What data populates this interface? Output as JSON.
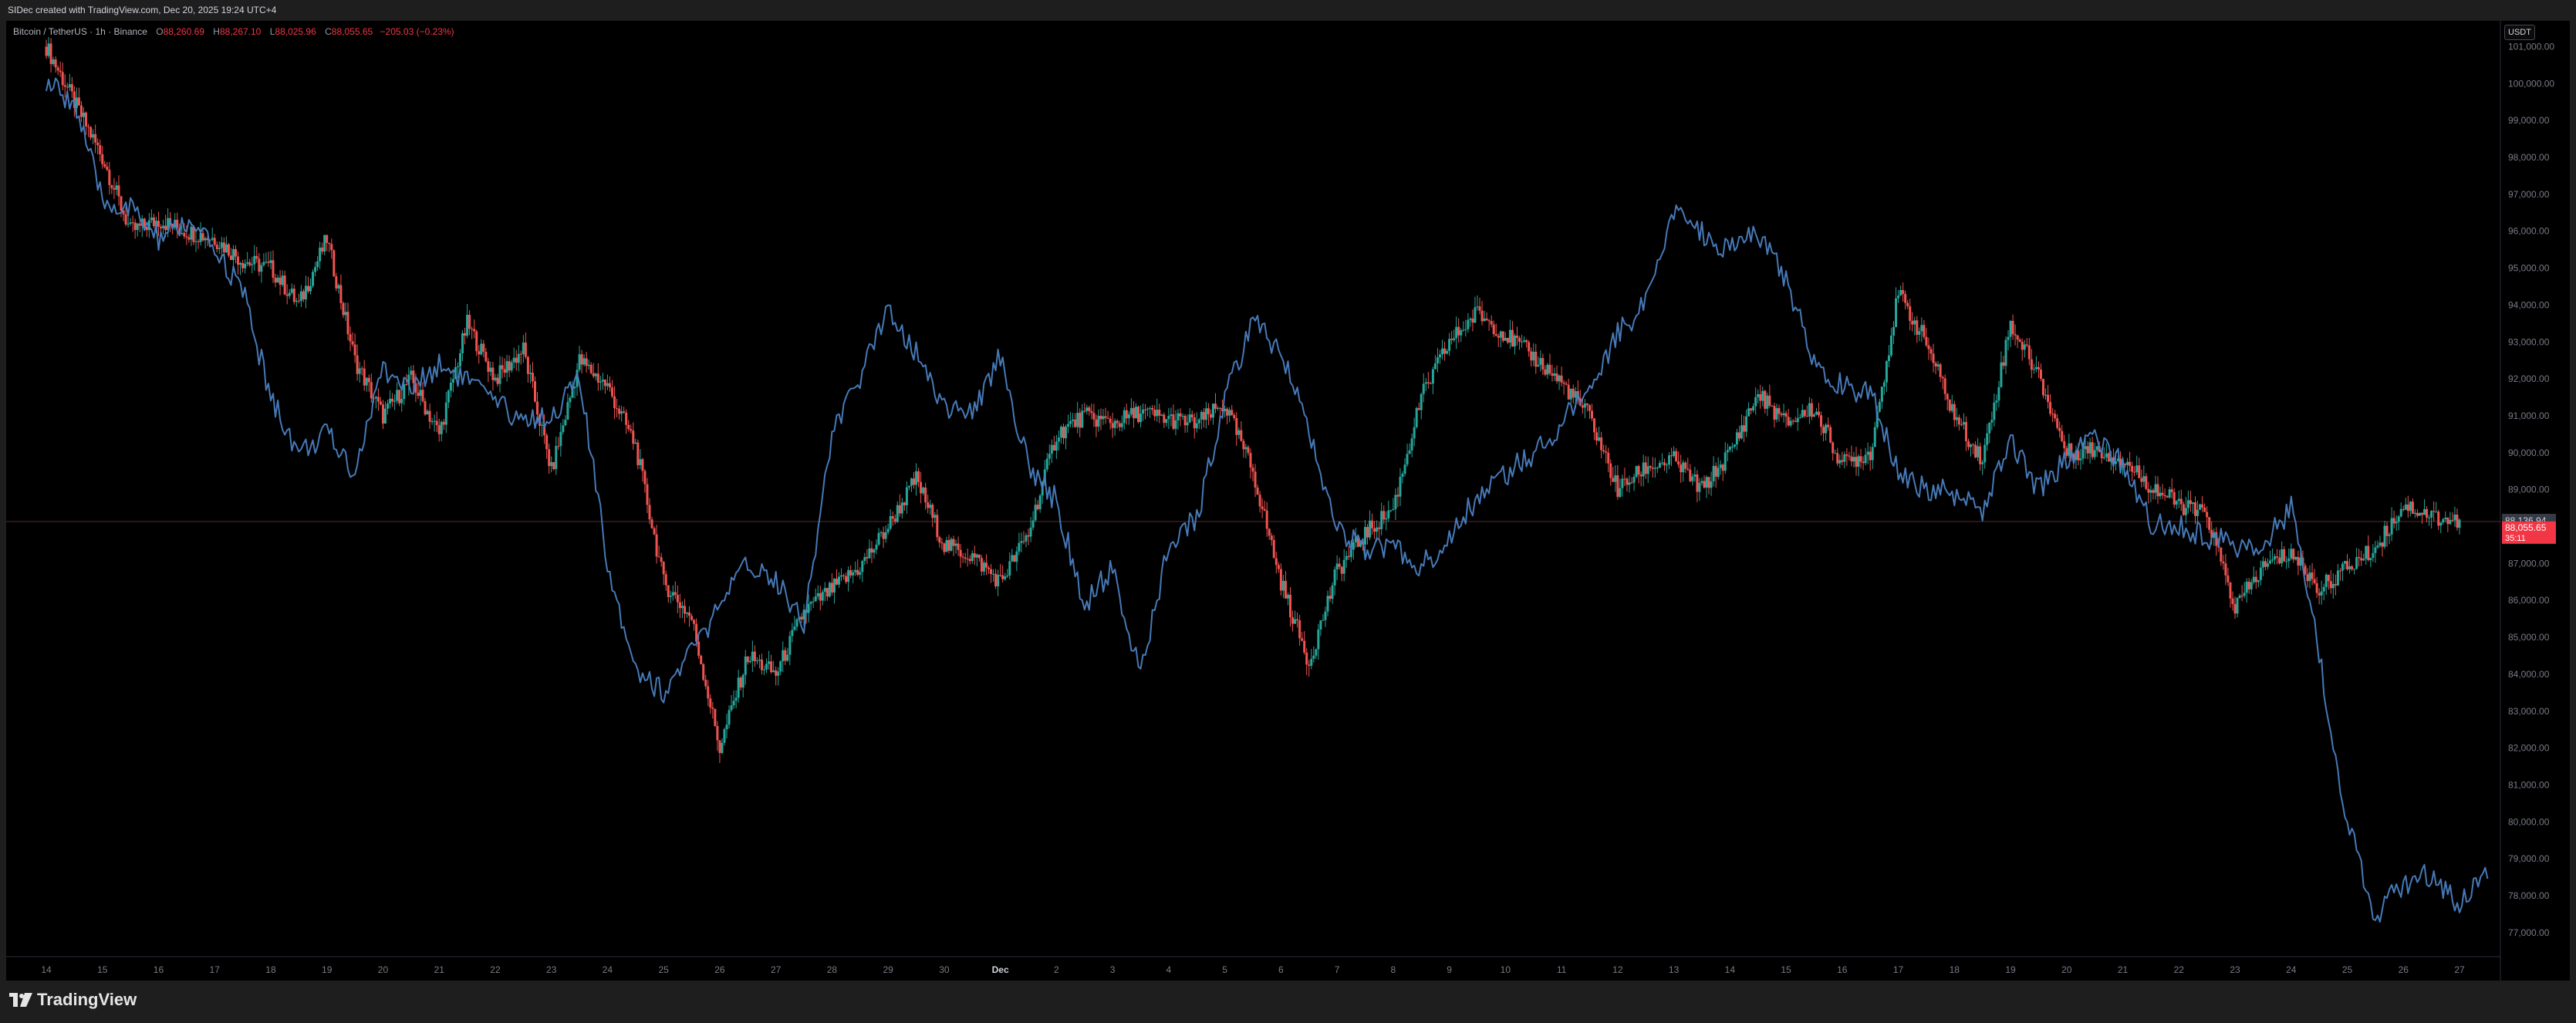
{
  "header": {
    "caption": "SIDec created with TradingView.com, Dec 20, 2025 19:24 UTC+4"
  },
  "legend": {
    "symbol": "Bitcoin / TetherUS · 1h · Binance",
    "o_label": "O",
    "o_value": "88,260.69",
    "h_label": "H",
    "h_value": "88,267.10",
    "l_label": "L",
    "l_value": "88,025.96",
    "c_label": "C",
    "c_value": "88,055.65",
    "change": "−205.03 (−0.23%)"
  },
  "axis": {
    "currency": "USDT"
  },
  "footer": {
    "brand": "TradingView"
  },
  "colors": {
    "up": "#26a69a",
    "down": "#ef5350",
    "overlay": "#4a7fc1",
    "grid_line": "#5a2a2a",
    "bg": "#000000",
    "axis_text": "#787b86",
    "price_tag": "#f23645",
    "crosshair_tag": "#363a45"
  },
  "chart_data": {
    "type": "line",
    "title": "Bitcoin / TetherUS · 1h · Binance",
    "y_tick_labels": [
      "101,000.00",
      "100,000.00",
      "99,000.00",
      "98,000.00",
      "97,000.00",
      "96,000.00",
      "95,000.00",
      "94,000.00",
      "93,000.00",
      "92,000.00",
      "91,000.00",
      "90,000.00",
      "89,000.00",
      "88,000.00",
      "87,000.00",
      "86,000.00",
      "85,000.00",
      "84,000.00",
      "83,000.00",
      "82,000.00",
      "81,000.00",
      "80,000.00",
      "79,000.00",
      "78,000.00",
      "77,000.00"
    ],
    "y_ticks": [
      101000,
      100000,
      99000,
      98000,
      97000,
      96000,
      95000,
      94000,
      93000,
      92000,
      91000,
      90000,
      89000,
      88000,
      87000,
      86000,
      85000,
      84000,
      83000,
      82000,
      81000,
      80000,
      79000,
      78000,
      77000
    ],
    "ylim": [
      76350,
      101700
    ],
    "x_tick_labels": [
      "14",
      "15",
      "16",
      "17",
      "18",
      "19",
      "20",
      "21",
      "22",
      "23",
      "24",
      "25",
      "26",
      "27",
      "28",
      "29",
      "30",
      "Dec",
      "2",
      "3",
      "4",
      "5",
      "6",
      "7",
      "8",
      "9",
      "10",
      "11",
      "12",
      "13",
      "14",
      "15",
      "16",
      "17",
      "18",
      "19",
      "20",
      "21",
      "22",
      "23",
      "24",
      "25",
      "26",
      "27"
    ],
    "price_tags": {
      "crosshair": "88,136.94",
      "last": "88,055.65",
      "countdown": "35:11"
    },
    "crosshair_value": 88137,
    "last_value": 88056,
    "series": [
      {
        "role": "candles",
        "style": "candlestick",
        "x": [
          0,
          0.5,
          1,
          1.5,
          2,
          2.5,
          3,
          3.5,
          4,
          4.5,
          5,
          5.5,
          6,
          6.5,
          7,
          7.5,
          8,
          8.5,
          9,
          9.5,
          10,
          10.5,
          11,
          11.5,
          12,
          12.5,
          13,
          13.5,
          14,
          14.5,
          15,
          15.5,
          16,
          16.5,
          17,
          17.5,
          18,
          18.5,
          19,
          19.5,
          20,
          20.5,
          21,
          21.5,
          22,
          22.5,
          23,
          23.5,
          24,
          24.5,
          25,
          25.5,
          26,
          26.5,
          27,
          27.5,
          28,
          28.5,
          29,
          29.5,
          30,
          30.5,
          31,
          31.5,
          32,
          32.5,
          33,
          33.5,
          34,
          34.5,
          35,
          35.5,
          36,
          36.5,
          37,
          37.5,
          38,
          38.5,
          39,
          39.5,
          40,
          40.5,
          41,
          41.5,
          42,
          42.5,
          43
        ],
        "values": [
          101000,
          99500,
          98000,
          96000,
          96300,
          96000,
          95800,
          95200,
          95000,
          94000,
          95800,
          92500,
          91000,
          92000,
          90500,
          93500,
          92000,
          92800,
          89500,
          92500,
          91800,
          90200,
          86500,
          85500,
          82000,
          84500,
          84000,
          85700,
          86300,
          86900,
          88000,
          89300,
          87500,
          87200,
          86500,
          87800,
          90500,
          91000,
          90800,
          91100,
          90900,
          90800,
          91300,
          89500,
          86500,
          84300,
          86800,
          87800,
          88500,
          91500,
          93000,
          93800,
          93200,
          92600,
          91900,
          91000,
          89000,
          89600,
          89800,
          89000,
          90000,
          91600,
          90800,
          91200,
          89700,
          90000,
          94300,
          93000,
          91000,
          89800,
          93500,
          92100,
          90000,
          90100,
          89800,
          89100,
          88600,
          88300,
          85800,
          86900,
          87300,
          86300,
          86900,
          87400,
          88600,
          88300,
          88100
        ]
      },
      {
        "role": "overlay",
        "style": "line",
        "x": [
          0,
          0.5,
          1,
          1.5,
          2,
          2.5,
          3,
          3.5,
          4,
          4.5,
          5,
          5.5,
          6,
          6.5,
          7,
          7.5,
          8,
          8.5,
          9,
          9.5,
          10,
          10.5,
          11,
          11.5,
          12,
          12.5,
          13,
          13.5,
          14,
          14.5,
          15,
          15.5,
          16,
          16.5,
          17,
          17.5,
          18,
          18.5,
          19,
          19.5,
          20,
          20.5,
          21,
          21.5,
          22,
          22.5,
          23,
          23.5,
          24,
          24.5,
          25,
          25.5,
          26,
          26.5,
          27,
          27.5,
          28,
          28.5,
          29,
          29.5,
          30,
          30.5,
          31,
          31.5,
          32,
          32.5,
          33,
          33.5,
          34,
          34.5,
          35,
          35.5,
          36,
          36.5,
          37,
          37.5,
          38,
          38.5,
          39,
          39.5,
          40,
          40.5,
          41,
          41.5,
          42,
          42.5,
          43,
          43.5
        ],
        "values": [
          100000,
          99500,
          96800,
          96600,
          95800,
          96200,
          95500,
          94400,
          91500,
          90000,
          90500,
          89500,
          92300,
          91700,
          92400,
          92000,
          91300,
          90900,
          91000,
          92000,
          87000,
          84200,
          83500,
          84600,
          85800,
          87000,
          86600,
          85400,
          90500,
          92000,
          94000,
          92700,
          91300,
          91000,
          92700,
          89600,
          88700,
          85800,
          86900,
          83900,
          87500,
          88200,
          91500,
          93500,
          92800,
          90600,
          88000,
          87300,
          87500,
          86900,
          87700,
          88800,
          89400,
          90000,
          90800,
          91700,
          93300,
          94000,
          96500,
          96000,
          95500,
          95900,
          94700,
          92500,
          91800,
          91600,
          89600,
          89000,
          88900,
          88400,
          90300,
          89000,
          89800,
          90400,
          89700,
          88100,
          88100,
          87700,
          87500,
          87600,
          88500,
          84500,
          80000,
          77500,
          78300,
          78600,
          77800,
          78800
        ]
      }
    ]
  }
}
